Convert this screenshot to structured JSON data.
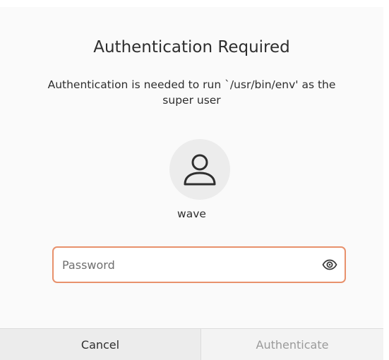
{
  "dialog": {
    "title": "Authentication Required",
    "message": "Authentication is needed to run `/usr/bin/env' as the super user",
    "user": {
      "name": "wave",
      "avatar_icon": "user-avatar-icon"
    },
    "password": {
      "placeholder": "Password",
      "value": "",
      "reveal_icon": "eye-icon"
    },
    "buttons": {
      "cancel": "Cancel",
      "authenticate": "Authenticate"
    }
  },
  "colors": {
    "focus_border": "#e8916c",
    "text": "#2e2e2e",
    "disabled_text": "#9a9a9a"
  }
}
